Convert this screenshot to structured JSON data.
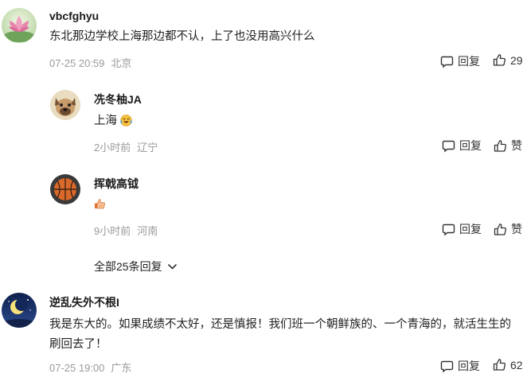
{
  "comments": [
    {
      "username": "vbcfghyu",
      "text": "东北那边学校上海那边都不认，上了也没用高兴什么",
      "time": "07-25 20:59",
      "location": "北京",
      "reply_label": "回复",
      "like_count": "29",
      "avatar_icon": "pink-lotus-icon"
    },
    {
      "username": "逆乱失外不根I",
      "text": "我是东大的。如果成绩不太好，还是慎报！我们班一个朝鲜族的、一个青海的，就活生生的刷回去了！",
      "time": "07-25 19:00",
      "location": "广东",
      "reply_label": "回复",
      "like_count": "62",
      "avatar_icon": "crescent-moon-night-icon"
    }
  ],
  "replies": [
    {
      "username": "冼冬柚JA",
      "text": "上海",
      "emoji": "laughing-tears-emoji",
      "time": "2小时前",
      "location": "辽宁",
      "reply_label": "回复",
      "like_label": "赞",
      "avatar_icon": "dog-avatar-icon"
    },
    {
      "username": "挥戟高钺",
      "text": "",
      "emoji": "thumbs-up-emoji",
      "time": "9小时前",
      "location": "河南",
      "reply_label": "回复",
      "like_label": "赞",
      "avatar_icon": "basketball-avatar-icon"
    }
  ],
  "expand_replies_label": "全部25条回复",
  "colors": {
    "meta_text": "#9a9a9a",
    "username": "#1a1a1a",
    "body_text": "#1f1f1f"
  }
}
